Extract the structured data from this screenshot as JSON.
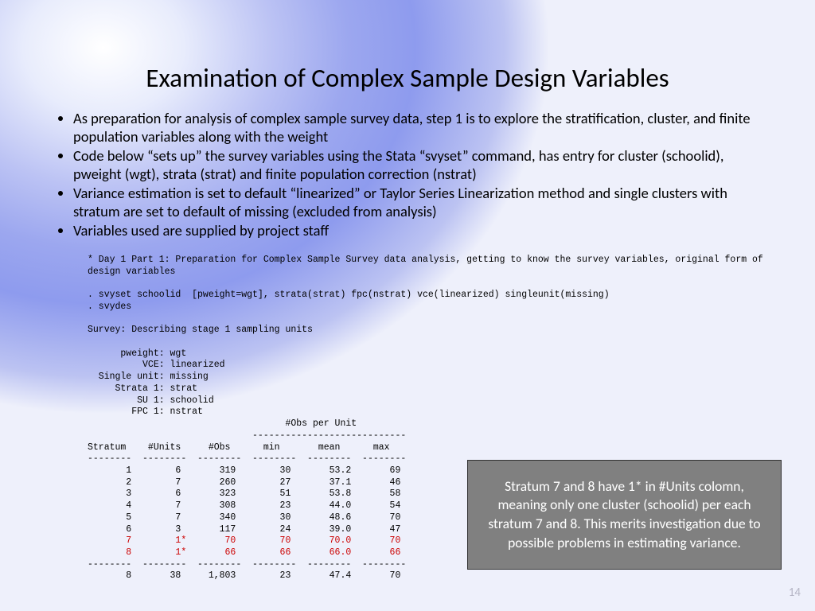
{
  "title": "Examination of Complex Sample Design Variables",
  "bullets": [
    "As preparation for analysis of complex sample survey data, step 1 is to explore the stratification, cluster, and finite population variables along with the weight",
    "Code below “sets up” the survey variables using the Stata “svyset” command, has entry for cluster (schoolid), pweight (wgt), strata (strat) and finite population correction (nstrat)",
    "Variance estimation is set to default “linearized” or Taylor Series Linearization method and single clusters with stratum are set to default of missing (excluded from analysis)",
    "Variables used are supplied by project staff"
  ],
  "code": {
    "comment": "* Day 1 Part 1: Preparation for Complex Sample Survey data analysis, getting to know the survey variables, original form of\ndesign variables",
    "cmd1": ". svyset schoolid  [pweight=wgt], strata(strat) fpc(nstrat) vce(linearized) singleunit(missing)",
    "cmd2": ". svydes",
    "heading": "Survey: Describing stage 1 sampling units",
    "settings": "      pweight: wgt\n          VCE: linearized\n  Single unit: missing\n     Strata 1: strat\n         SU 1: schoolid\n        FPC 1: nstrat",
    "obs_header": "                                    #Obs per Unit\n                              ----------------------------",
    "table_header": "Stratum    #Units     #Obs      min       mean      max",
    "dash_row": "--------  --------  --------  --------  --------  --------",
    "rows": [
      "       1        6       319        30       53.2       69",
      "       2        7       260        27       37.1       46",
      "       3        6       323        51       53.8       58",
      "       4        7       308        23       44.0       54",
      "       5        7       340        30       48.6       70",
      "       6        3       117        24       39.0       47"
    ],
    "red_rows": [
      "       7        1*       70        70       70.0       70",
      "       8        1*       66        66       66.0       66"
    ],
    "total": "       8       38     1,803        23       47.4       70"
  },
  "callout": "Stratum 7 and 8 have 1* in #Units colomn, meaning only one cluster (schoolid) per each stratum 7 and 8.  This merits investigation due to possible problems in estimating variance.",
  "page_number": "14"
}
